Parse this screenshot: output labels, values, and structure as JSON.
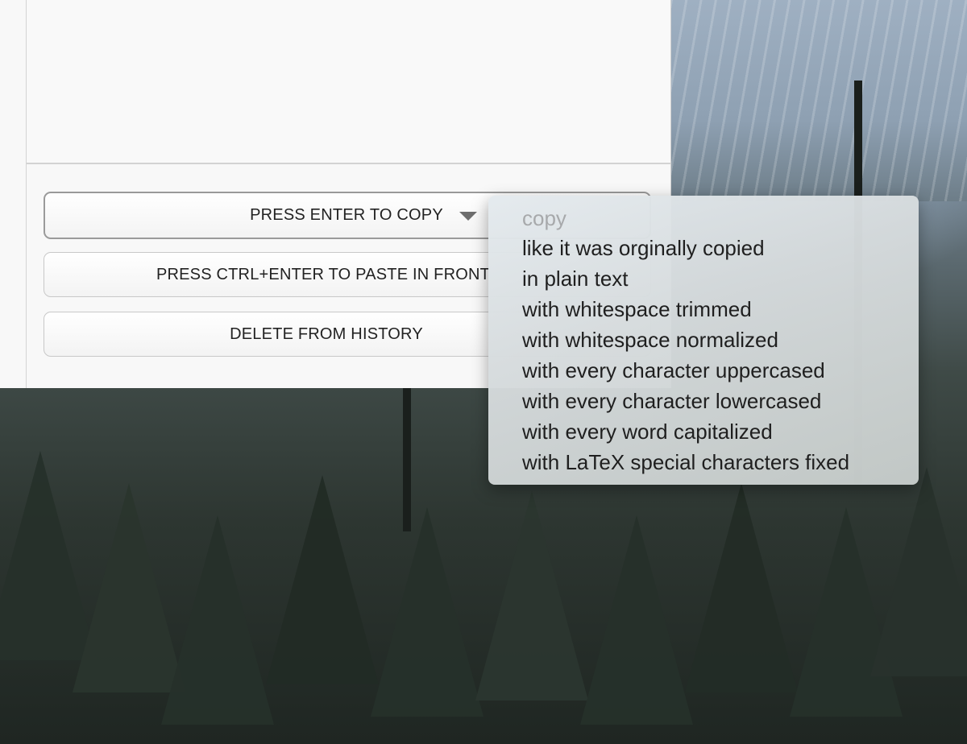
{
  "buttons": {
    "copy_label": "PRESS ENTER TO COPY",
    "paste_label": "PRESS CTRL+ENTER TO PASTE IN FRONT",
    "delete_label": "DELETE FROM HISTORY"
  },
  "copy_menu": {
    "header": "copy",
    "items": [
      "like it was orginally copied",
      "in plain text",
      "with whitespace trimmed",
      "with whitespace normalized",
      "with every character uppercased",
      "with every character lowercased",
      "with every word capitalized",
      "with LaTeX special characters fixed"
    ]
  },
  "icons": {
    "dropdown": "chevron-down-icon"
  }
}
